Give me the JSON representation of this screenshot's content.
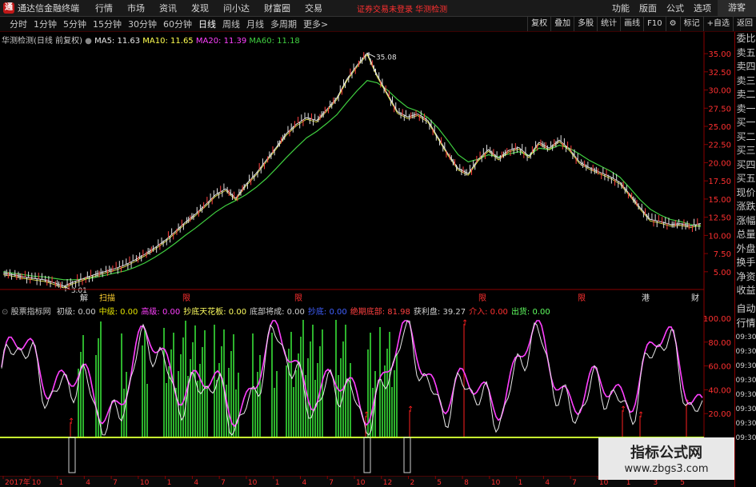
{
  "app": {
    "title": "通达信金融终端",
    "notice": "证券交易未登录  华测检测",
    "guest": "游客"
  },
  "menu": [
    "行情",
    "市场",
    "资讯",
    "发现",
    "问小达",
    "财富圈",
    "交易"
  ],
  "right_menu": [
    "功能",
    "版面",
    "公式",
    "选项"
  ],
  "periods": [
    "分时",
    "1分钟",
    "5分钟",
    "15分钟",
    "30分钟",
    "60分钟",
    "日线",
    "周线",
    "月线",
    "多周期",
    "更多>"
  ],
  "active_period": "日线",
  "tools": [
    "复权",
    "叠加",
    "多股",
    "统计",
    "画线",
    "F10",
    "标记",
    "+自选",
    "返回"
  ],
  "main_legend": {
    "title": "华测检测(日线 前复权)",
    "ma5": "MA5: 11.63",
    "ma10": "MA10: 11.65",
    "ma20": "MA20: 11.39",
    "ma60": "MA60: 11.18"
  },
  "main_axis": [
    "35.00",
    "32.50",
    "30.00",
    "27.50",
    "25.00",
    "22.50",
    "20.00",
    "17.50",
    "15.00",
    "12.50",
    "10.00",
    "7.50",
    "5.00"
  ],
  "price_marks": {
    "high": "35.08",
    "low": "3.01"
  },
  "event_labels": [
    "解",
    "扫描",
    "限",
    "港",
    "财"
  ],
  "indicator_legend": {
    "name": "股票指标网",
    "items": [
      {
        "label": "初级: 0.00",
        "color": "#d0d0d0"
      },
      {
        "label": "中级: 0.00",
        "color": "#e0e000"
      },
      {
        "label": "高级: 0.00",
        "color": "#ff40ff"
      },
      {
        "label": "抄底天花板: 0.00",
        "color": "#ffff60"
      },
      {
        "label": "底部将成: 0.00",
        "color": "#d0d0d0"
      },
      {
        "label": "抄底: 0.00",
        "color": "#4060ff"
      },
      {
        "label": "绝期底部: 81.98",
        "color": "#ff4040"
      },
      {
        "label": "获利盘: 39.27",
        "color": "#d0d0d0"
      },
      {
        "label": "介入: 0.00",
        "color": "#ff3030"
      },
      {
        "label": "出货: 0.00",
        "color": "#60ff60"
      }
    ]
  },
  "indicator_axis": [
    "100.00",
    "80.00",
    "60.00",
    "40.00",
    "20.00"
  ],
  "time_axis": [
    "2017年",
    "10",
    "1",
    "4",
    "7",
    "10",
    "1",
    "4",
    "7",
    "10",
    "1",
    "4",
    "7",
    "10",
    "12",
    "2",
    "5",
    "8",
    "10",
    "1",
    "4",
    "7",
    "10",
    "1",
    "3",
    "5"
  ],
  "info_top": [
    "委比",
    "卖五",
    "卖四",
    "卖三",
    "卖二",
    "卖一",
    "买一",
    "买二",
    "买三",
    "买四",
    "买五",
    "现价",
    "涨跌",
    "涨幅",
    "总量",
    "外盘",
    "换手",
    "净资",
    "收益"
  ],
  "info_bottom": [
    "自动",
    "行情",
    "09:30",
    "09:30",
    "09:30",
    "09:30",
    "09:30",
    "09:30",
    "09:30",
    "09:30"
  ],
  "watermark": {
    "line1": "指标公式网",
    "line2": "www.zbgs3.com"
  },
  "colors": {
    "price": "#e8e8e8",
    "ma": "#ffff50",
    "ma60": "#40d040",
    "magenta": "#ff40ff",
    "green": "#40ff40",
    "red_marker": "#ff2020"
  },
  "chart_data": {
    "type": "line",
    "title": "华测检测(日线 前复权)",
    "ylim": [
      3.0,
      36.0
    ],
    "series": [
      {
        "name": "price",
        "values": [
          4.8,
          4.6,
          4.3,
          4.1,
          3.9,
          3.5,
          3.01,
          3.6,
          4.1,
          4.6,
          5.0,
          5.4,
          5.9,
          6.6,
          7.4,
          8.3,
          9.3,
          10.5,
          11.8,
          12.9,
          14.2,
          15.6,
          16.4,
          15.1,
          17.0,
          18.5,
          20.3,
          22.1,
          24.0,
          25.3,
          26.2,
          25.8,
          27.3,
          28.9,
          31.5,
          33.4,
          35.08,
          32.0,
          29.5,
          27.0,
          26.3,
          26.7,
          25.8,
          23.5,
          21.2,
          19.2,
          18.5,
          20.5,
          21.8,
          20.6,
          21.7,
          22.1,
          20.9,
          22.8,
          22.0,
          23.1,
          21.9,
          20.1,
          19.3,
          18.7,
          18.1,
          17.3,
          15.6,
          13.8,
          12.2,
          11.9,
          11.5,
          11.6,
          11.3,
          11.63
        ]
      },
      {
        "name": "MA60",
        "values": [
          5.0,
          4.8,
          4.6,
          4.4,
          4.3,
          4.1,
          3.9,
          3.9,
          4.0,
          4.2,
          4.5,
          4.8,
          5.1,
          5.6,
          6.2,
          7.0,
          7.9,
          8.9,
          10.0,
          11.0,
          12.1,
          13.2,
          14.1,
          14.8,
          15.6,
          16.6,
          17.8,
          19.2,
          20.7,
          22.1,
          23.4,
          24.3,
          25.4,
          26.6,
          28.3,
          29.9,
          31.3,
          31.0,
          30.0,
          28.7,
          27.6,
          27.1,
          26.2,
          24.8,
          23.0,
          21.1,
          20.1,
          20.5,
          21.1,
          20.8,
          21.2,
          21.5,
          21.0,
          22.0,
          21.8,
          22.4,
          22.0,
          21.2,
          20.3,
          19.6,
          18.9,
          18.0,
          16.5,
          14.9,
          13.6,
          12.8,
          12.2,
          11.9,
          11.5,
          11.18
        ]
      }
    ]
  }
}
